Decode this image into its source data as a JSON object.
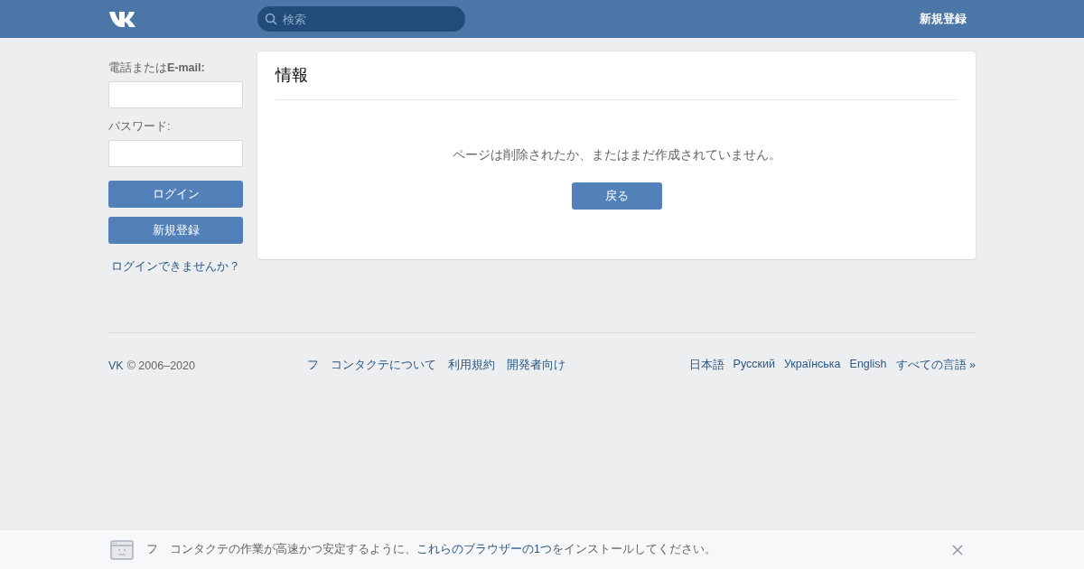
{
  "header": {
    "search": {
      "placeholder": "検索"
    },
    "signup_link": "新規登録"
  },
  "login": {
    "phone_label_prefix": "電話または",
    "phone_label_bold": "E-mail:",
    "password_label": "パスワード:",
    "login_button": "ログイン",
    "signup_button": "新規登録",
    "forgot_link": "ログインできませんか？"
  },
  "panel": {
    "title": "情報",
    "message": "ページは削除されたか、またはまだ作成されていません。",
    "back_button": "戻る"
  },
  "footer": {
    "brand": "VK",
    "copyright": "© 2006–2020",
    "links": [
      "フ",
      "コンタクテについて",
      "利用規約",
      "開発者向け"
    ],
    "languages": [
      "日本語",
      "Русский",
      "Українська",
      "English",
      "すべての言語 »"
    ]
  },
  "banner": {
    "before": "フ　コンタクテの作業が高速かつ安定するように、",
    "link": "これらのブラウザーの1つ",
    "after": "をインストールしてください。"
  }
}
